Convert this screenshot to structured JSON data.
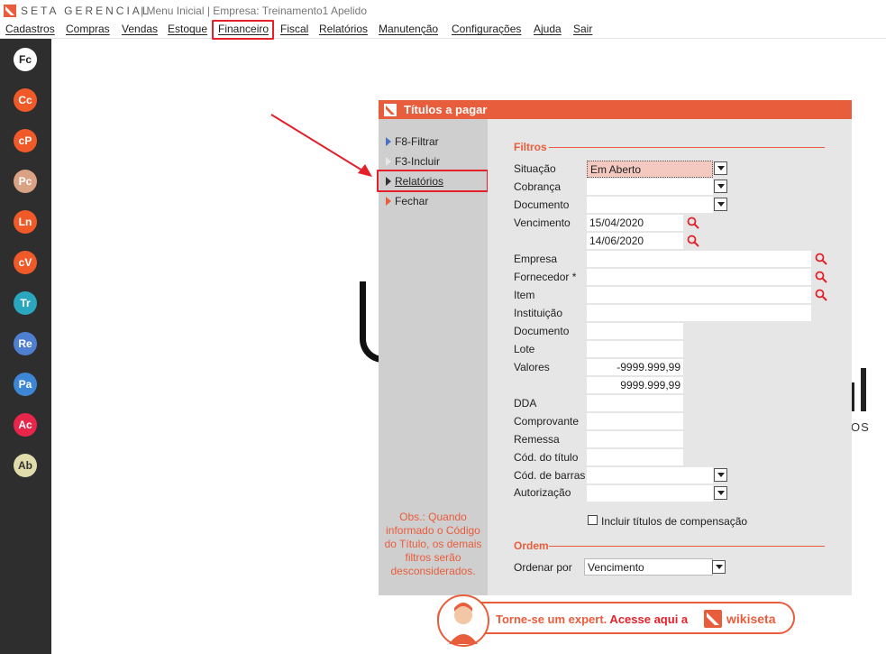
{
  "window": {
    "brand": "SETA GERENCIAL",
    "title_rest": "| Menu Inicial | Empresa: Treinamento1 Apelido"
  },
  "menu": [
    {
      "label": "Cadastros"
    },
    {
      "label": "Compras"
    },
    {
      "label": "Vendas"
    },
    {
      "label": "Estoque"
    },
    {
      "label": "Financeiro",
      "highlighted": true
    },
    {
      "label": "Fiscal"
    },
    {
      "label": "Relatórios"
    },
    {
      "label": "Manutenção"
    },
    {
      "label": "Configurações"
    },
    {
      "label": "Ajuda"
    },
    {
      "label": "Sair"
    }
  ],
  "sidebar": [
    {
      "label": "Fc",
      "color": "#ffffff",
      "text_color": "#222222"
    },
    {
      "label": "Cc",
      "color": "#f05a28"
    },
    {
      "label": "cP",
      "color": "#f05a28"
    },
    {
      "label": "Pc",
      "color": "#d9a285"
    },
    {
      "label": "Ln",
      "color": "#f05a28"
    },
    {
      "label": "cV",
      "color": "#f05a28"
    },
    {
      "label": "Tr",
      "color": "#2aa6bf"
    },
    {
      "label": "Re",
      "color": "#4f7fd1"
    },
    {
      "label": "Pa",
      "color": "#3d86d6"
    },
    {
      "label": "Ac",
      "color": "#e8254a"
    },
    {
      "label": "Ab",
      "color": "#e0dcab",
      "text_color": "#333333"
    }
  ],
  "dialog": {
    "title": "Títulos a pagar",
    "actions": [
      {
        "label": "F8-Filtrar",
        "marker": "blue-triangle"
      },
      {
        "label": "F3-Incluir",
        "marker": "grey-triangle"
      },
      {
        "label": "Relatórios",
        "marker": "dark-triangle",
        "highlighted": true
      },
      {
        "label": "Fechar",
        "marker": "orange-triangle"
      }
    ],
    "obs": "Obs.: Quando informado o Código do Título, os demais filtros serão desconsiderados.",
    "filters_title": "Filtros",
    "filters": {
      "situacao": {
        "label": "Situação",
        "value": "Em Aberto"
      },
      "cobranca": {
        "label": "Cobrança",
        "value": ""
      },
      "documento_sel": {
        "label": "Documento",
        "value": ""
      },
      "vencimento": {
        "label": "Vencimento",
        "from": "15/04/2020",
        "to": "14/06/2020"
      },
      "empresa": {
        "label": "Empresa",
        "value": ""
      },
      "fornecedor": {
        "label": "Fornecedor *",
        "value": ""
      },
      "item": {
        "label": "Item",
        "value": ""
      },
      "instituicao": {
        "label": "Instituição",
        "value": ""
      },
      "documento": {
        "label": "Documento",
        "value": ""
      },
      "lote": {
        "label": "Lote",
        "value": ""
      },
      "valores": {
        "label": "Valores",
        "min": "-9999.999,99",
        "max": "9999.999,99"
      },
      "dda": {
        "label": "DDA",
        "value": ""
      },
      "comprovante": {
        "label": "Comprovante",
        "value": ""
      },
      "remessa": {
        "label": "Remessa",
        "value": ""
      },
      "cod_titulo": {
        "label": "Cód. do título",
        "value": ""
      },
      "cod_barras": {
        "label": "Cód. de barras",
        "value": ""
      },
      "autorizacao": {
        "label": "Autorização",
        "value": ""
      }
    },
    "compensacao_label": "Incluir títulos de compensação",
    "compensacao_checked": false,
    "order_title": "Ordem",
    "order_label": "Ordenar por",
    "order_value": "Vencimento"
  },
  "banner": {
    "text_main": "Torne-se um expert. Acesse aqui a",
    "brand": "wikiseta"
  },
  "colors": {
    "accent": "#e85d3c",
    "highlight_box": "#e4212a",
    "sidebar_bg": "#2e2e2e",
    "situacao_bg": "#f3c9c0"
  }
}
